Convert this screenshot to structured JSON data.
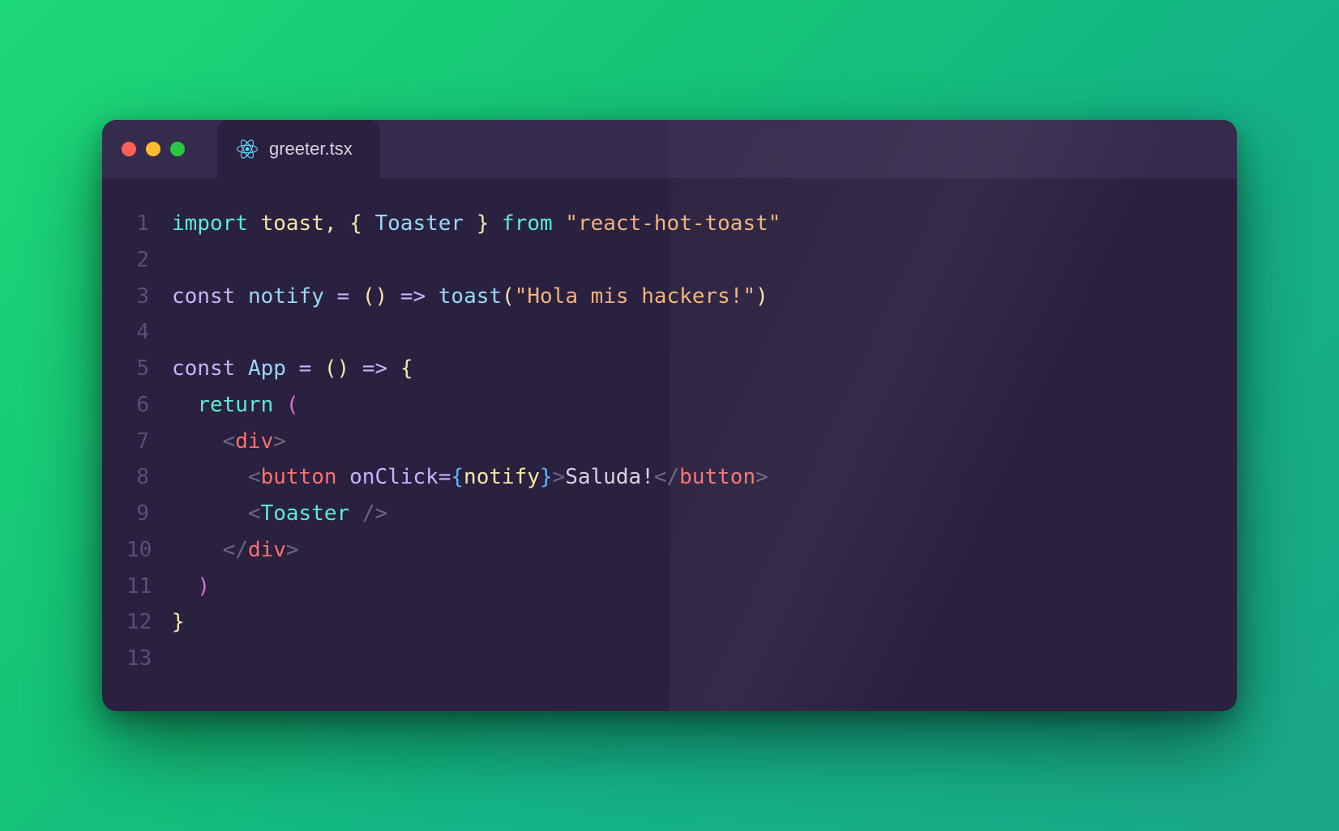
{
  "tab": {
    "filename": "greeter.tsx"
  },
  "gutter": [
    "1",
    "2",
    "3",
    "4",
    "5",
    "6",
    "7",
    "8",
    "9",
    "10",
    "11",
    "12",
    "13"
  ],
  "tok": {
    "import": "import",
    "from": "from",
    "const": "const",
    "return": "return",
    "toast": "toast",
    "Toaster": "Toaster",
    "notify": "notify",
    "App": "App",
    "onClick": "onClick",
    "div": "div",
    "button": "button",
    "modStr": "\"react-hot-toast\"",
    "msgStr": "\"Hola mis hackers!\"",
    "btnText": "Saluda!",
    "eq": "=",
    "arrow": "=>",
    "comma": ",",
    "lbraceY": "{",
    "rbraceY": "}",
    "lbraceP": "{",
    "rbraceP": "}",
    "lbraceB": "{",
    "rbraceB": "}",
    "lparenY": "(",
    "rparenY": ")",
    "lparenP": "(",
    "rparenP": ")",
    "lparenB": "(",
    "rparenB": ")",
    "lt": "<",
    "gt": ">",
    "ltSlash": "</",
    "slashGt": "/>",
    "sp": " ",
    "sp2": "  ",
    "sp4": "    ",
    "sp6": "      "
  }
}
